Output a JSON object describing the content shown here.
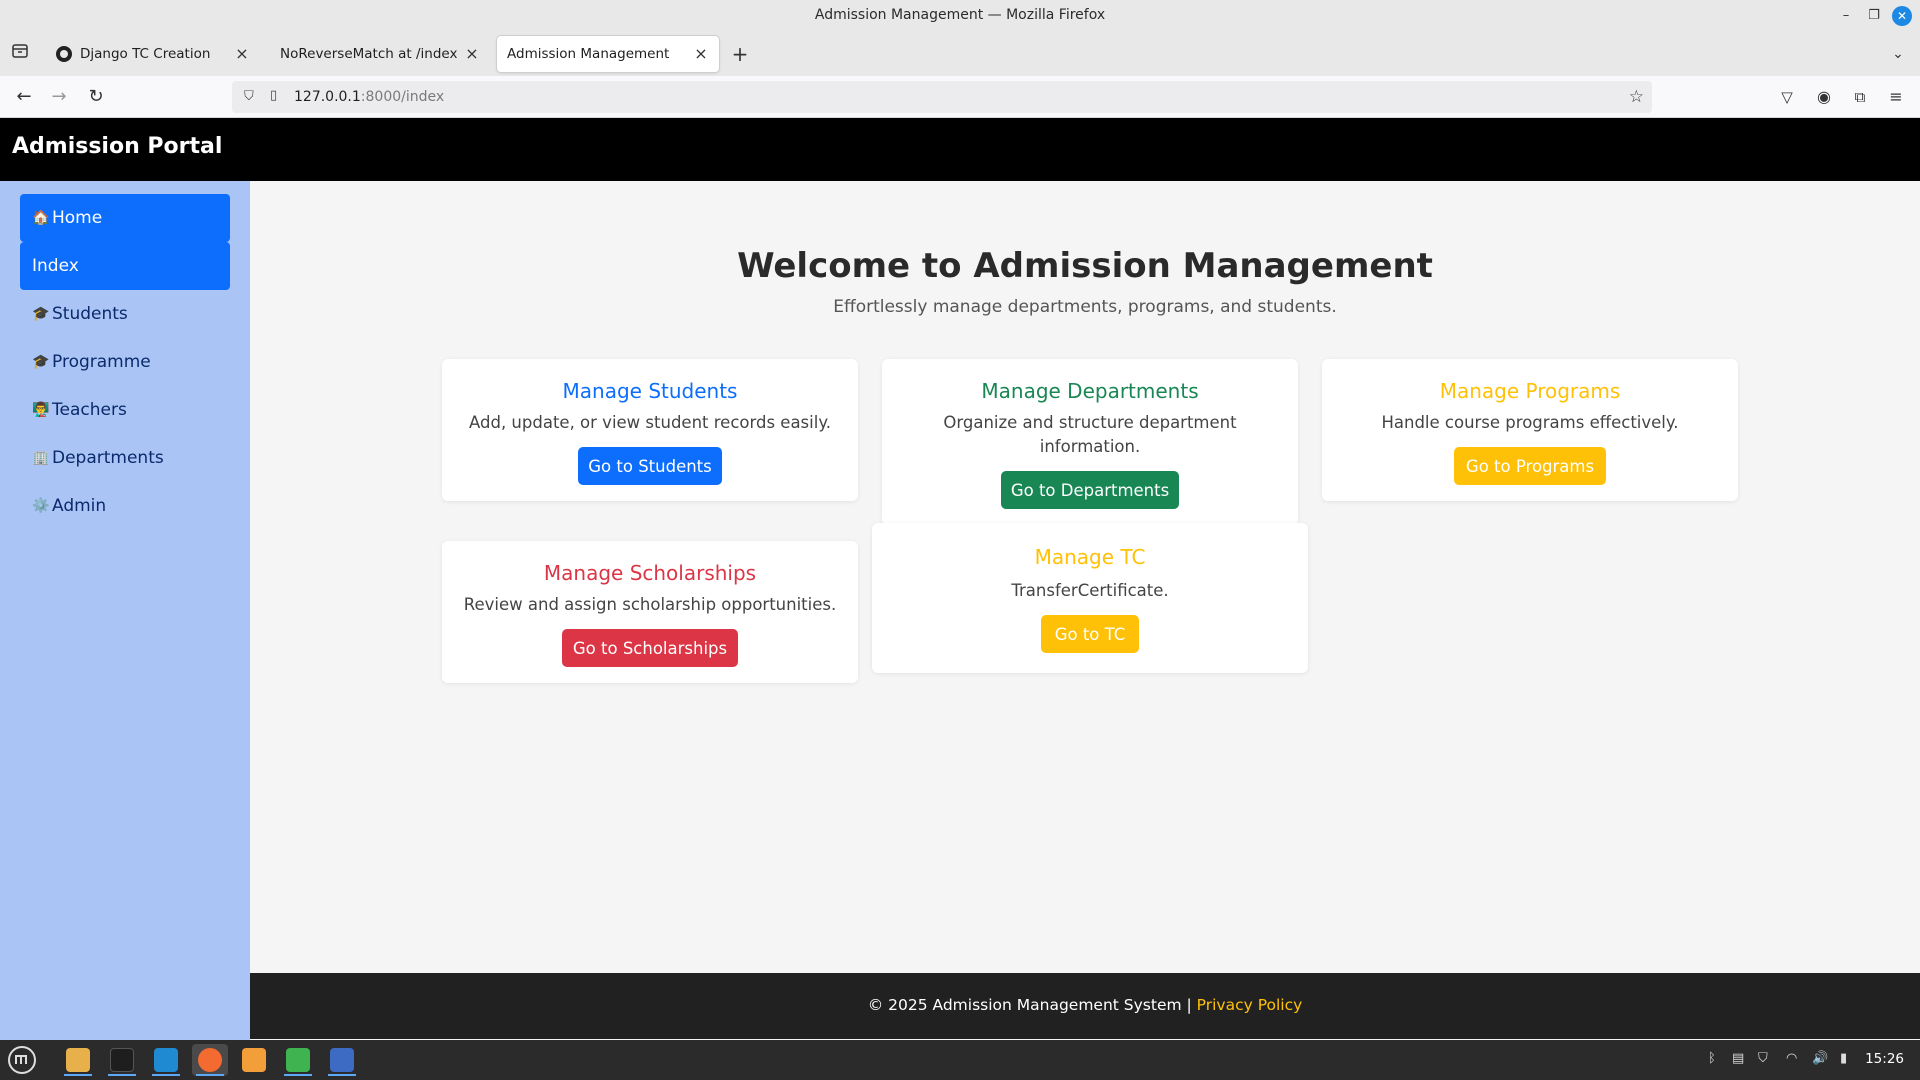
{
  "window": {
    "title": "Admission Management — Mozilla Firefox"
  },
  "tabs": [
    {
      "label": "Django TC Creation",
      "icon": "github-icon",
      "active": false
    },
    {
      "label": "NoReverseMatch at /index",
      "icon": "none",
      "active": false
    },
    {
      "label": "Admission Management",
      "icon": "none",
      "active": true
    }
  ],
  "url": {
    "host": "127.0.0.1",
    "path": ":8000/index"
  },
  "header": {
    "brand": "Admission Portal"
  },
  "sidebar": {
    "items": [
      {
        "icon": "🏠",
        "label": "Home",
        "active": true
      },
      {
        "icon": "",
        "label": "Index",
        "active": true
      },
      {
        "icon": "🎓",
        "label": "Students",
        "active": false
      },
      {
        "icon": "🎓",
        "label": "Programme",
        "active": false
      },
      {
        "icon": "👨‍🏫",
        "label": "Teachers",
        "active": false
      },
      {
        "icon": "🏢",
        "label": "Departments",
        "active": false
      },
      {
        "icon": "⚙️",
        "label": "Admin",
        "active": false
      }
    ]
  },
  "main": {
    "title": "Welcome to Admission Management",
    "subtitle": "Effortlessly manage departments, programs, and students.",
    "cards": {
      "students": {
        "title": "Manage Students",
        "desc": "Add, update, or view student records easily.",
        "button": "Go to Students",
        "color": "#0d6efd"
      },
      "departments": {
        "title": "Manage Departments",
        "desc": "Organize and structure department information.",
        "button": "Go to Departments",
        "color": "#198754"
      },
      "programs": {
        "title": "Manage Programs",
        "desc": "Handle course programs effectively.",
        "button": "Go to Programs",
        "color": "#ffc107"
      },
      "scholarships": {
        "title": "Manage Scholarships",
        "desc": "Review and assign scholarship opportunities.",
        "button": "Go to Scholarships",
        "color": "#dc3545"
      },
      "tc": {
        "title": "Manage TC",
        "desc": "TransferCertificate.",
        "button": "Go to TC",
        "color": "#ffc107"
      }
    }
  },
  "footer": {
    "text": "© 2025 Admission Management System | ",
    "link": "Privacy Policy"
  },
  "taskbar": {
    "clock": "15:26"
  }
}
